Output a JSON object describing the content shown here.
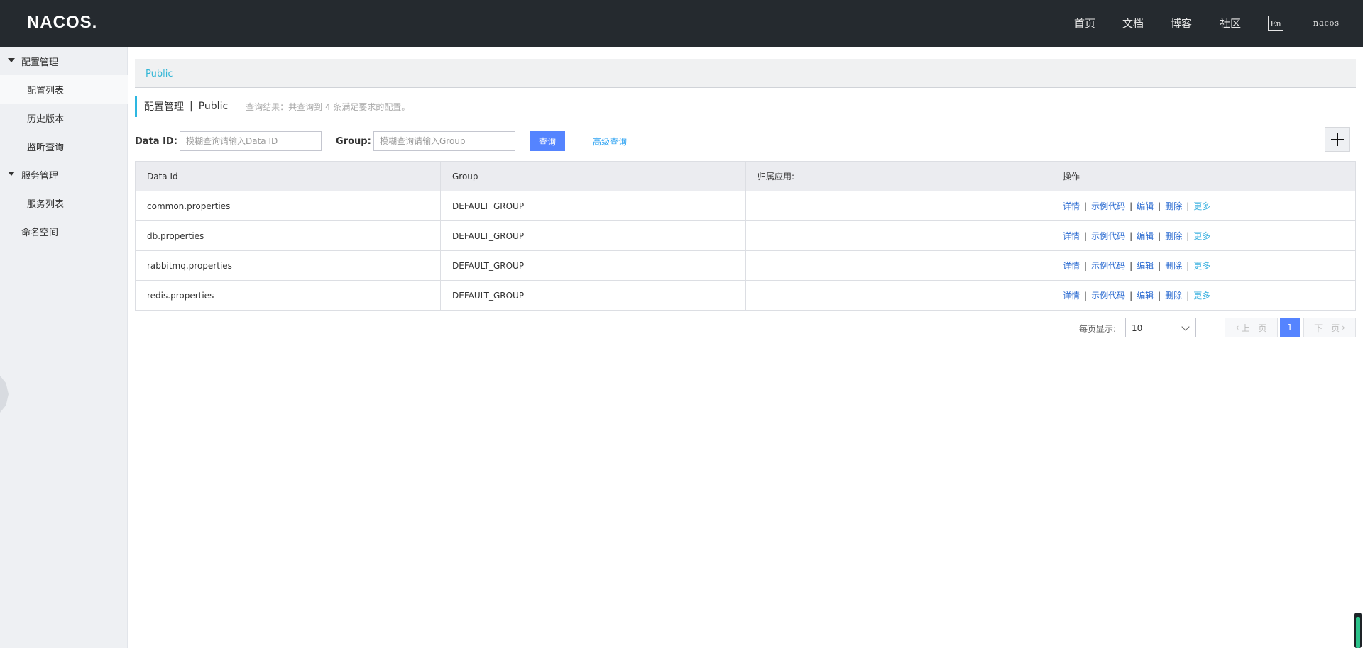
{
  "brand": {
    "logo": "NACOS."
  },
  "topnav": {
    "items": [
      "首页",
      "文档",
      "博客",
      "社区"
    ],
    "lang": "En",
    "user": "nacos"
  },
  "sidebar": {
    "groups": [
      {
        "label": "配置管理",
        "items": [
          "配置列表",
          "历史版本",
          "监听查询"
        ]
      },
      {
        "label": "服务管理",
        "items": [
          "服务列表"
        ]
      }
    ],
    "namespace_label": "命名空间"
  },
  "breadcrumb": {
    "namespace": "Public"
  },
  "title": {
    "main": "配置管理",
    "separator": "|",
    "namespace": "Public",
    "hint": "查询结果：共查询到 4 条满足要求的配置。"
  },
  "search": {
    "data_id_label": "Data ID:",
    "data_id_placeholder": "模糊查询请输入Data ID",
    "group_label": "Group:",
    "group_placeholder": "模糊查询请输入Group",
    "query_button": "查询",
    "advanced_link": "高级查询"
  },
  "table": {
    "headers": [
      "Data Id",
      "Group",
      "归属应用:",
      "操作"
    ],
    "rows": [
      {
        "data_id": "common.properties",
        "group": "DEFAULT_GROUP",
        "app": ""
      },
      {
        "data_id": "db.properties",
        "group": "DEFAULT_GROUP",
        "app": ""
      },
      {
        "data_id": "rabbitmq.properties",
        "group": "DEFAULT_GROUP",
        "app": ""
      },
      {
        "data_id": "redis.properties",
        "group": "DEFAULT_GROUP",
        "app": ""
      }
    ],
    "actions": [
      "详情",
      "示例代码",
      "编辑",
      "删除",
      "更多"
    ]
  },
  "pagination": {
    "per_page_label": "每页显示:",
    "page_size": "10",
    "prev": "上一页",
    "current": "1",
    "next": "下一页"
  }
}
